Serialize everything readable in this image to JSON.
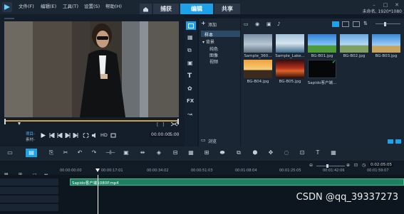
{
  "menubar": {
    "items": [
      "文件(F)",
      "编辑(E)",
      "工具(T)",
      "设置(S)",
      "帮助(H)"
    ]
  },
  "tabs": [
    {
      "label": "捕获"
    },
    {
      "label": "编辑"
    },
    {
      "label": "共享"
    }
  ],
  "project": {
    "label": "未命名, 1920*1080"
  },
  "player": {
    "project_label": "项目-",
    "clip_label": "素材-",
    "timecode": "00:00:00",
    "hd_label": "HD",
    "zoom_label": "5:00"
  },
  "library": {
    "add_label": "添加",
    "tree": {
      "root": "样本",
      "group": "背景",
      "children": [
        "纯色",
        "图像",
        "视频"
      ]
    },
    "browse_label": "浏览",
    "thumbnails": [
      {
        "name": "Sample_360...",
        "kind": "video"
      },
      {
        "name": "Sample_Lake...",
        "kind": "video"
      },
      {
        "name": "BG-B01.jpg",
        "kind": "image"
      },
      {
        "name": "BG-B02.jpg",
        "kind": "image"
      },
      {
        "name": "BG-B03.jpg",
        "kind": "image"
      },
      {
        "name": "BG-B04.jpg",
        "kind": "image"
      },
      {
        "name": "BG-B05.jpg",
        "kind": "image"
      },
      {
        "name": "Sapido客户端...",
        "kind": "video"
      }
    ]
  },
  "timeline": {
    "ruler_times": [
      "00:00:00:00",
      "00:00:17:01",
      "00:00:34:02",
      "00:00:51:03",
      "00:01:08:04",
      "00:01:25:05",
      "00:01:42:06",
      "00:01:59:07"
    ],
    "clip_label": "Sapido客户端1080P.mp4",
    "current_time": "0:02:05:05"
  },
  "watermark": "CSDN @qq_39337273",
  "colors": {
    "accent": "#1da1e8",
    "clip": "#1e7f63",
    "chrome": "#1b2633"
  }
}
